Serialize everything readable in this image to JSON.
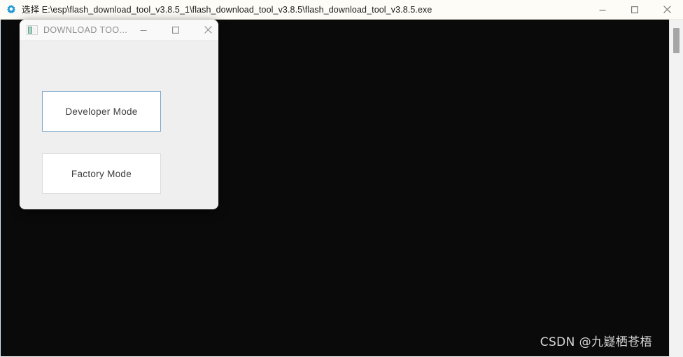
{
  "outer_window": {
    "icon": "gear-icon",
    "accent_color": "#1e9ad6",
    "title": "选择 E:\\esp\\flash_download_tool_v3.8.5_1\\flash_download_tool_v3.8.5\\flash_download_tool_v3.8.5.exe",
    "controls": {
      "minimize": "minimize-icon",
      "maximize": "maximize-icon",
      "close": "close-icon"
    },
    "background_color": "#fdfcf6"
  },
  "console": {
    "background_color": "#0a0a0a",
    "bottom_text": "",
    "scrollbar": {
      "thumb_color": "#a6a6a6",
      "track_color": "#f2f2f2"
    }
  },
  "dialog": {
    "icon": "download-tool-app-icon",
    "title": "DOWNLOAD TOO...",
    "controls": {
      "minimize": "minimize-icon",
      "maximize": "maximize-icon",
      "close": "close-icon"
    },
    "background_color": "#efefef",
    "buttons": [
      {
        "id": "developer-mode",
        "label": "Developer Mode",
        "state": "focused",
        "border_color": "#7ba7cc"
      },
      {
        "id": "factory-mode",
        "label": "Factory Mode",
        "state": "normal",
        "border_color": "#dcdcdc"
      }
    ]
  },
  "watermark": {
    "text": "CSDN @九嶷栖苍梧",
    "color": "#d6d6d6"
  }
}
